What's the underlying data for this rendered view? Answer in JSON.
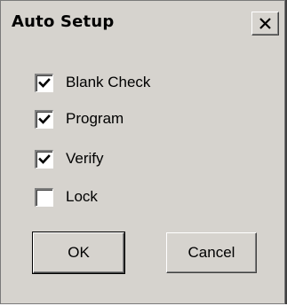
{
  "window": {
    "title": "Auto Setup",
    "close_glyph": "X"
  },
  "options": [
    {
      "label": "Blank Check",
      "checked": true
    },
    {
      "label": "Program",
      "checked": true
    },
    {
      "label": "Verify",
      "checked": true
    },
    {
      "label": "Lock",
      "checked": false
    }
  ],
  "buttons": {
    "ok_label": "OK",
    "cancel_label": "Cancel"
  },
  "icons": {
    "close": "close-icon",
    "check": "checkmark-icon"
  },
  "colors": {
    "dialog_face": "#d6d3ce",
    "checkbox_fill": "#ffffff",
    "text": "#000000"
  }
}
